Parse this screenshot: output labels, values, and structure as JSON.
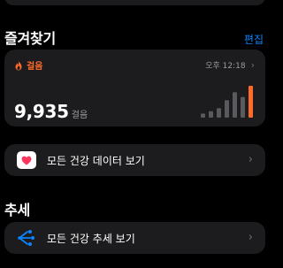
{
  "favorites": {
    "title": "즐겨찾기",
    "edit_label": "편집"
  },
  "steps_card": {
    "category": "걸음",
    "time": "오후 12:18",
    "value": "9,935",
    "unit": "걸음",
    "accent_color": "#ff6a2a",
    "bar_levels": [
      0.13,
      0.2,
      0.3,
      0.55,
      0.8,
      0.65,
      1.0
    ]
  },
  "all_health_data": {
    "label": "모든 건강 데이터 보기",
    "icon": "heart-icon"
  },
  "trends": {
    "title": "추세",
    "all_trends": {
      "label": "모든 건강 추세 보기",
      "icon": "trends-icon"
    }
  }
}
